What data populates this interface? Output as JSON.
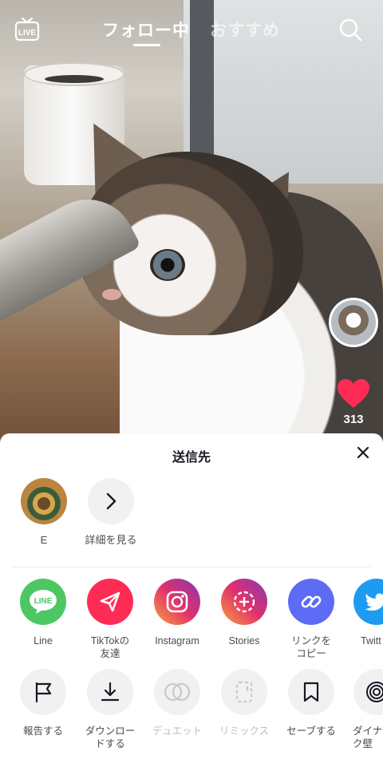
{
  "topbar": {
    "live_label": "LIVE",
    "tab_following": "フォロー中",
    "tab_recommended": "おすすめ"
  },
  "video": {
    "like_count": "313",
    "heart_color": "#fe2c55"
  },
  "share_sheet": {
    "title": "送信先",
    "contacts": [
      {
        "label": "E"
      },
      {
        "label": "詳細を見る"
      }
    ],
    "share_targets": [
      {
        "label": "Line",
        "icon": "line-icon",
        "color": "#4cc764"
      },
      {
        "label": "TikTokの\n友達",
        "icon": "send-icon",
        "color": "#fe2c55"
      },
      {
        "label": "Instagram",
        "icon": "instagram-icon",
        "color": "#d62976"
      },
      {
        "label": "Stories",
        "icon": "stories-icon",
        "color": "#c13584"
      },
      {
        "label": "リンクを\nコピー",
        "icon": "link-icon",
        "color": "#5d6bf5"
      },
      {
        "label": "Twitt",
        "icon": "twitter-icon",
        "color": "#1d9bf0"
      }
    ],
    "actions": [
      {
        "label": "報告する",
        "icon": "flag-icon",
        "enabled": true
      },
      {
        "label": "ダウンロー\nドする",
        "icon": "download-icon",
        "enabled": true
      },
      {
        "label": "デュエット",
        "icon": "duet-icon",
        "enabled": false
      },
      {
        "label": "リミックス",
        "icon": "remix-icon",
        "enabled": false
      },
      {
        "label": "セーブする",
        "icon": "bookmark-icon",
        "enabled": true
      },
      {
        "label": "ダイナ\nク壁",
        "icon": "dynamic-wallpaper-icon",
        "enabled": true
      }
    ]
  }
}
